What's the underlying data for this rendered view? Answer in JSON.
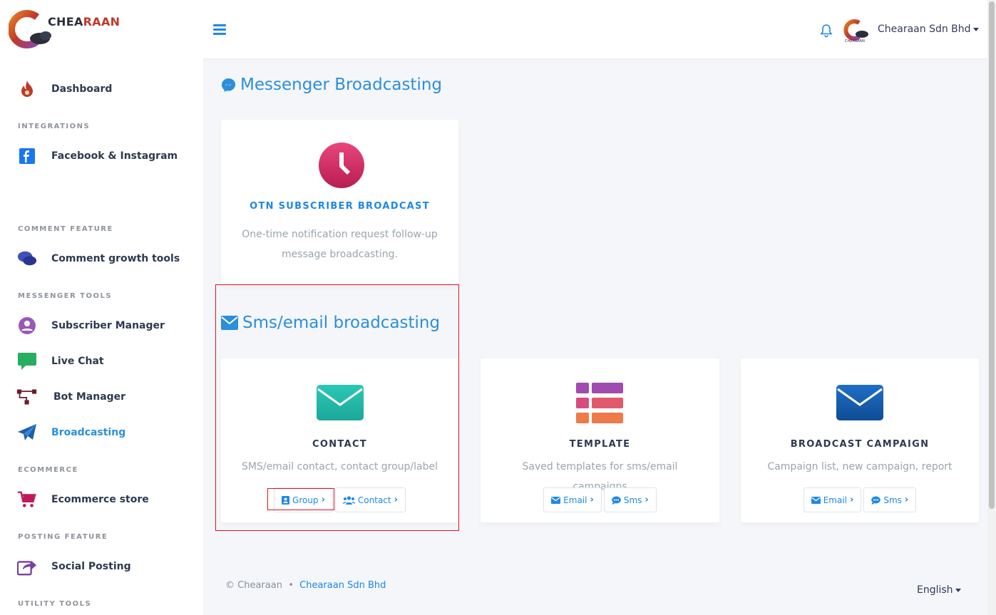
{
  "brand": {
    "logo_text_a": "CHEA",
    "logo_text_b": "RAAN"
  },
  "navbar": {
    "user_name": "Chearaan Sdn Bhd"
  },
  "sidebar": {
    "dashboard": "Dashboard",
    "h_integrations": "INTEGRATIONS",
    "facebook_instagram": "Facebook & Instagram",
    "h_comment": "COMMENT FEATURE",
    "comment_growth": "Comment growth tools",
    "h_messenger": "MESSENGER TOOLS",
    "subscriber_manager": "Subscriber Manager",
    "live_chat": "Live Chat",
    "bot_manager": "Bot Manager",
    "broadcasting": "Broadcasting",
    "h_ecommerce": "ECOMMERCE",
    "ecommerce_store": "Ecommerce store",
    "h_posting": "POSTING FEATURE",
    "social_posting": "Social Posting",
    "h_utility": "UTILITY TOOLS"
  },
  "main": {
    "messenger_title": "Messenger Broadcasting",
    "otn": {
      "title": "OTN SUBSCRIBER BROADCAST",
      "desc": "One-time notification request follow-up message broadcasting."
    },
    "sms_title": "Sms/email broadcasting",
    "contact": {
      "title": "CONTACT",
      "desc": "SMS/email contact, contact group/label",
      "btn_group": "Group",
      "btn_contact": "Contact"
    },
    "template": {
      "title": "TEMPLATE",
      "desc": "Saved templates for sms/email campaigns",
      "btn_email": "Email",
      "btn_sms": "Sms"
    },
    "campaign": {
      "title": "BROADCAST CAMPAIGN",
      "desc": "Campaign list, new campaign, report",
      "btn_email": "Email",
      "btn_sms": "Sms"
    }
  },
  "footer": {
    "copyright": "© Chearaan",
    "separator": "•",
    "company_link": "Chearaan Sdn Bhd",
    "language": "English"
  },
  "colors": {
    "accent": "#2b8fdb",
    "link": "#1e88e5",
    "highlight": "#e0141e",
    "title_dark": "#2d3a4f"
  }
}
